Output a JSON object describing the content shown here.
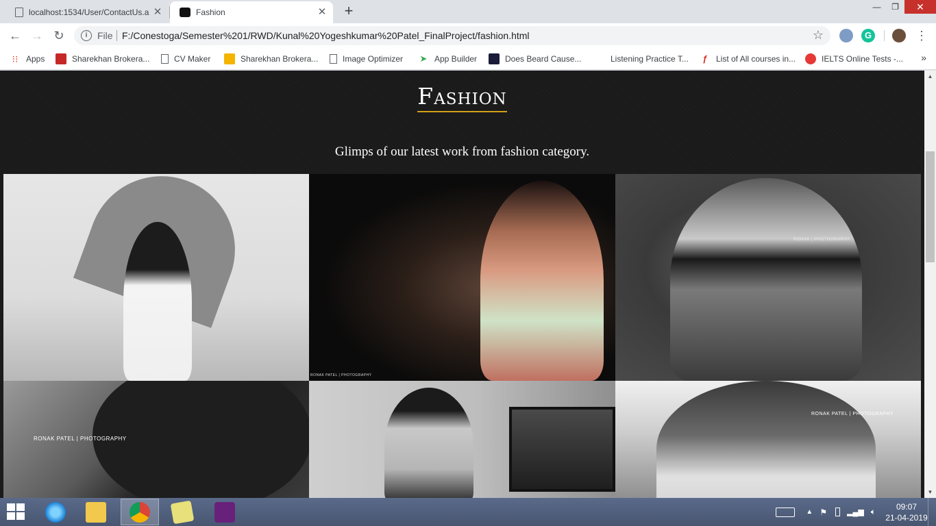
{
  "browser": {
    "tabs": [
      {
        "title": "localhost:1534/User/ContactUs.a",
        "active": false
      },
      {
        "title": "Fashion",
        "active": true
      }
    ],
    "new_tab": "+",
    "address": {
      "scheme_label": "File",
      "url": "F:/Conestoga/Semester%201/RWD/Kunal%20Yogeshkumar%20Patel_FinalProject/fashion.html"
    },
    "bookmarks": [
      {
        "label": "Apps",
        "icon": "apps-grid-icon"
      },
      {
        "label": "Sharekhan Brokera...",
        "icon": "sharekhan-icon"
      },
      {
        "label": "CV Maker",
        "icon": "page-icon"
      },
      {
        "label": "Sharekhan Brokera...",
        "icon": "chart-icon"
      },
      {
        "label": "Image Optimizer",
        "icon": "page-icon"
      },
      {
        "label": "App Builder",
        "icon": "paper-plane-icon"
      },
      {
        "label": "Does Beard Cause...",
        "icon": "book-icon"
      },
      {
        "label": "Listening Practice T...",
        "icon": "none"
      },
      {
        "label": "List of All courses in...",
        "icon": "quiz-icon"
      },
      {
        "label": "IELTS Online Tests -...",
        "icon": "ielts-icon"
      }
    ],
    "bookmarks_more": "»"
  },
  "page": {
    "title": "Fashion",
    "subtitle": "Glimps of our latest work from fashion category.",
    "accent_color": "#d4a017",
    "background_color": "#1a1a1a",
    "watermarks": [
      "RONAK PATEL | PHOTOGRAPHY",
      "RONAK | PHOTOGRAPHY",
      "RONAK PATEL | PHOTOGRAPHY",
      "RONAK PATEL | PHOTOGRAPHY"
    ]
  },
  "taskbar": {
    "apps": [
      "start-icon",
      "internet-explorer-icon",
      "file-explorer-icon",
      "chrome-icon",
      "sticky-notes-icon",
      "visual-studio-icon"
    ],
    "time": "09:07",
    "date": "21-04-2019"
  }
}
